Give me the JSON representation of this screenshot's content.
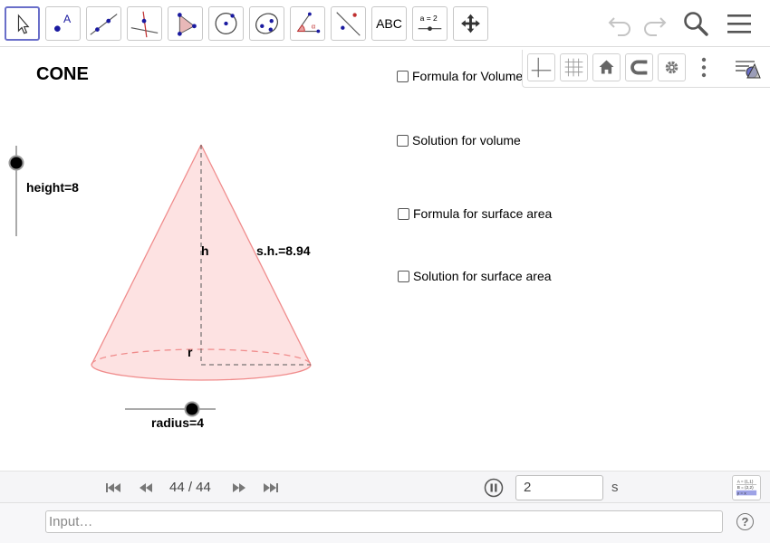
{
  "toolbar": {
    "tools": [
      {
        "name": "Move"
      },
      {
        "name": "Point"
      },
      {
        "name": "Line"
      },
      {
        "name": "Perpendicular Line"
      },
      {
        "name": "Polygon"
      },
      {
        "name": "Circle with Center"
      },
      {
        "name": "Ellipse"
      },
      {
        "name": "Angle"
      },
      {
        "name": "Reflect about Line"
      },
      {
        "name": "Text",
        "label": "ABC"
      },
      {
        "name": "Slider",
        "label": "a = 2"
      },
      {
        "name": "Move Graphics View"
      }
    ],
    "icons": [
      "undo-icon",
      "redo-icon",
      "search-icon",
      "menu-icon"
    ]
  },
  "stylebar": {
    "icons": [
      "axes-icon",
      "grid-icon",
      "home-icon",
      "magnet-icon",
      "gear-icon",
      "more-icon",
      "stylebar-toggle-icon"
    ]
  },
  "graphics": {
    "title": "CONE",
    "height_label": "height=8",
    "h_label": "h",
    "slant_label": "s.h.=8.94",
    "r_label": "r",
    "radius_label": "radius=4",
    "height_value": 8,
    "radius_value": 4,
    "checkboxes": [
      {
        "label": "Formula for Volume",
        "checked": false
      },
      {
        "label": "Solution for volume",
        "checked": false
      },
      {
        "label": "Formula for surface area",
        "checked": false
      },
      {
        "label": "Solution for surface area",
        "checked": false
      }
    ],
    "cone_color": "#f08c8c"
  },
  "animation": {
    "frame": "44 / 44",
    "speed": "2",
    "unit": "s"
  },
  "input": {
    "placeholder": "Input…",
    "help": "?"
  },
  "colors": {
    "accent": "#6a6fc9",
    "point": "#1a1aa0"
  }
}
